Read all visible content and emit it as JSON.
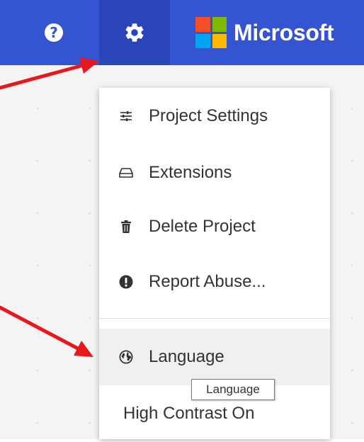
{
  "colors": {
    "topbar": "#3454d1",
    "topbar_active": "#2a45b8",
    "arrow": "#e8171c",
    "ms_red": "#f25022",
    "ms_green": "#7fba00",
    "ms_blue": "#00a4ef",
    "ms_yellow": "#ffb900"
  },
  "header": {
    "help_icon": "question-circle-icon",
    "help_glyph": "?",
    "settings_icon": "gear-icon",
    "brand_name": "Microsoft"
  },
  "menu": {
    "items": [
      {
        "label": "Project Settings",
        "icon": "sliders-icon"
      },
      {
        "label": "Extensions",
        "icon": "extensions-icon"
      },
      {
        "label": "Delete Project",
        "icon": "trash-icon"
      },
      {
        "label": "Report Abuse...",
        "icon": "exclamation-circle-icon"
      },
      {
        "label": "Language",
        "icon": "globe-icon"
      },
      {
        "label": "High Contrast On"
      }
    ]
  },
  "tooltip": {
    "text": "Language"
  }
}
